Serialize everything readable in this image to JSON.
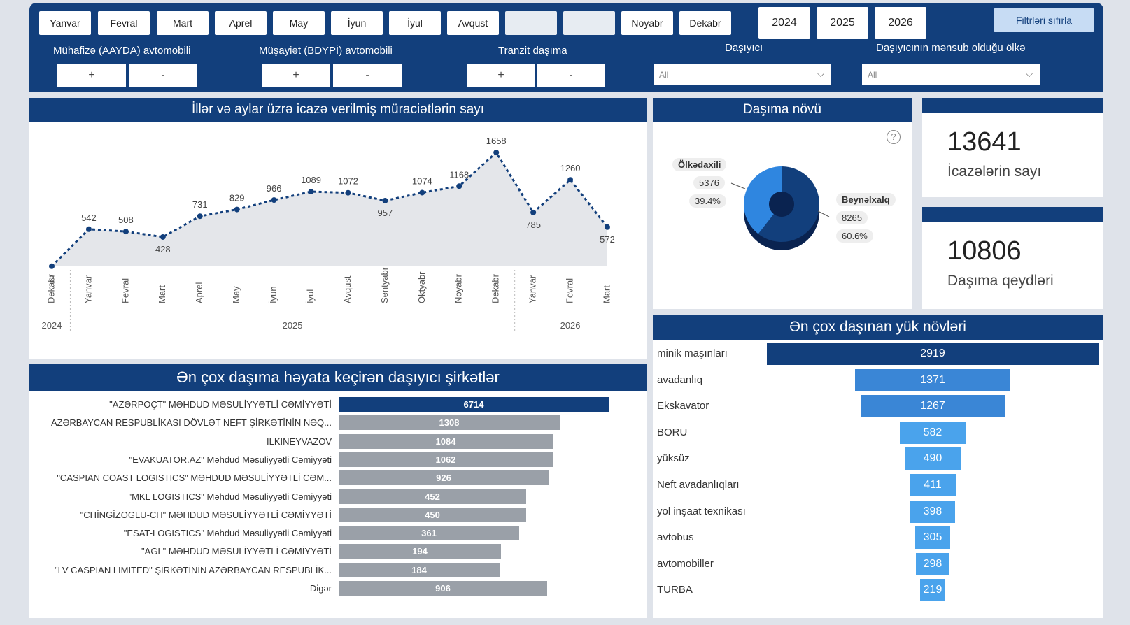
{
  "filters": {
    "months": [
      "Yanvar",
      "Fevral",
      "Mart",
      "Aprel",
      "May",
      "İyun",
      "İyul",
      "Avqust",
      "Noyabr",
      "Dekabr"
    ],
    "years": [
      "2024",
      "2025",
      "2026"
    ],
    "reset_label": "Filtrləri sıfırla",
    "groups": [
      {
        "label": "Mühafizə (AAYDA) avtomobili",
        "plus": "+",
        "minus": "-"
      },
      {
        "label": "Müşayiət (BDYPİ) avtomobili",
        "plus": "+",
        "minus": "-"
      },
      {
        "label": "Tranzit daşıma",
        "plus": "+",
        "minus": "-"
      }
    ],
    "carrier": {
      "label": "Daşıyıcı",
      "value": "All"
    },
    "country": {
      "label": "Daşıyıcının mənsub olduğu ölkə",
      "value": "All"
    }
  },
  "line_panel": {
    "title": "İllər və aylar üzrə icazə verilmiş müraciətlərin sayı",
    "year_labels": [
      "2024",
      "2025",
      "2026"
    ]
  },
  "chart_data": [
    {
      "type": "line",
      "categories": [
        "Dekabr",
        "Yanvar",
        "Fevral",
        "Mart",
        "Aprel",
        "May",
        "İyun",
        "İyul",
        "Avqust",
        "Sentyabr",
        "Oktyabr",
        "Noyabr",
        "Dekabr",
        "Yanvar",
        "Fevral",
        "Mart"
      ],
      "years": [
        "2024",
        "2025",
        "2025",
        "2025",
        "2025",
        "2025",
        "2025",
        "2025",
        "2025",
        "2025",
        "2025",
        "2025",
        "2025",
        "2026",
        "2026",
        "2026"
      ],
      "values": [
        2,
        542,
        508,
        428,
        731,
        829,
        966,
        1089,
        1072,
        957,
        1074,
        1168,
        1658,
        785,
        1260,
        572
      ],
      "title": "İllər və aylar üzrə icazə verilmiş müraciətlərin sayı",
      "ylim": [
        0,
        1700
      ]
    },
    {
      "type": "pie",
      "title": "Daşıma növü",
      "slices": [
        {
          "name": "Ölkədaxili",
          "value": 5376,
          "percent": "39.4%",
          "color": "#2f86e0"
        },
        {
          "name": "Beynəlxalq",
          "value": 8265,
          "percent": "60.6%",
          "color": "#123f7c"
        }
      ]
    },
    {
      "type": "bar",
      "title": "Ən çox daşıma həyata keçirən daşıyıcı şirkətlər",
      "categories": [
        "\"AZƏRPOÇT\" MƏHDUD MƏSULİYYƏTLİ CƏMİYYƏTİ",
        "AZƏRBAYCAN RESPUBLİKASI DÖVLƏT NEFT ŞİRKƏTİNİN NƏQ...",
        "ILKINEYVAZOV",
        "\"EVAKUATOR.AZ\" Məhdud Məsuliyyətli Cəmiyyəti",
        "\"CASPIAN COAST LOGISTICS\" MƏHDUD MƏSULİYYƏTLİ CƏM...",
        "\"MKL LOGISTICS\" Məhdud Məsuliyyətli Cəmiyyəti",
        "\"CHİNGİZOGLU-CH\" MƏHDUD MƏSULİYYƏTLİ CƏMİYYƏTİ",
        "\"ESAT-LOGISTICS\" Məhdud Məsuliyyətli Cəmiyyəti",
        "\"AGL\" MƏHDUD MƏSULİYYƏTLİ CƏMİYYƏTİ",
        "\"LV CASPIAN LIMITED\" ŞİRKƏTİNİN AZƏRBAYCAN RESPUBLİK...",
        "Digər"
      ],
      "values": [
        6714,
        1308,
        1084,
        1062,
        926,
        452,
        450,
        361,
        194,
        184,
        906
      ],
      "colors": {
        "top": "#123f7c",
        "rest": "#9aa0a8"
      }
    },
    {
      "type": "bar",
      "title": "Ən çox daşınan yük növləri",
      "categories": [
        "minik maşınları",
        "avadanlıq",
        "Ekskavator",
        "BORU",
        "yüksüz",
        "Neft avadanlıqları",
        "yol inşaat texnikası",
        "avtobus",
        "avtomobiller",
        "TURBA"
      ],
      "values": [
        2919,
        1371,
        1267,
        582,
        490,
        411,
        398,
        305,
        298,
        219
      ],
      "colors": [
        "#123f7c",
        "#3a86d6",
        "#3a86d6",
        "#4aa3ec",
        "#4aa3ec",
        "#4aa3ec",
        "#4aa3ec",
        "#4aa3ec",
        "#4aa3ec",
        "#4aa3ec"
      ]
    }
  ],
  "kpis": [
    {
      "value": "13641",
      "label": "İcazələrin sayı"
    },
    {
      "value": "10806",
      "label": "Daşıma qeydləri"
    }
  ]
}
